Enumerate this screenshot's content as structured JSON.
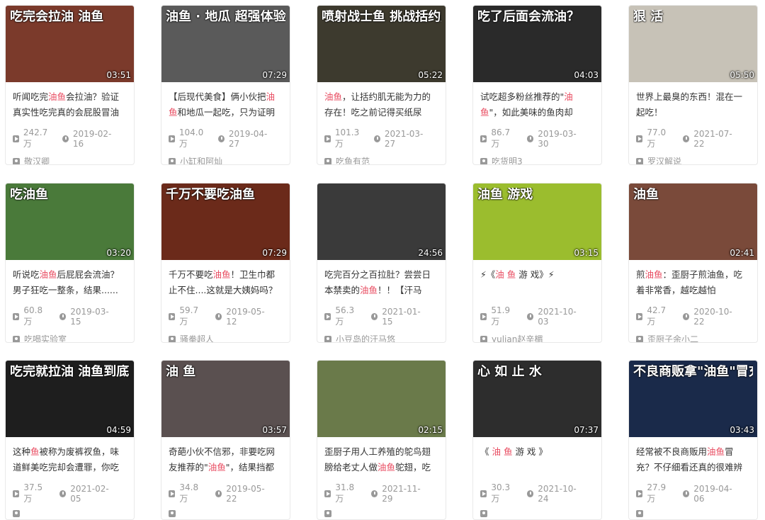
{
  "colors": {
    "highlight": "#e84a5f",
    "meta": "#999999",
    "title": "#333333"
  },
  "cards": [
    {
      "overlay": "吃完会拉油 油鱼",
      "duration": "03:51",
      "title_pre": "听闻吃完",
      "title_hl": "油鱼",
      "title_post": "会拉油？验证真实性吃完真的会屁股冒油",
      "views": "242.7万",
      "date": "2019-02-16",
      "author": "敬汉卿"
    },
    {
      "overlay": "油鱼 · 地瓜 超强体验",
      "duration": "07:29",
      "title_pre": "【后现代美食】俩小伙把",
      "title_hl": "油鱼",
      "title_post": "和地瓜一起吃，只为证明",
      "views": "104.0万",
      "date": "2019-04-27",
      "author": "小缸和阿灿"
    },
    {
      "overlay": "喷射战士鱼 挑战括约肌",
      "duration": "05:22",
      "title_pre": "",
      "title_hl": "油鱼",
      "title_post": "，让括约肌无能为力的存在！吃之前记得买纸尿",
      "views": "101.3万",
      "date": "2021-03-27",
      "author": "吃鱼有范"
    },
    {
      "overlay": "吃了后面会流油？",
      "duration": "04:03",
      "title_pre": "试吃超多粉丝推荐的\"",
      "title_hl": "油鱼",
      "title_post": "\"，如此美味的鱼肉却",
      "views": "86.7万",
      "date": "2019-03-30",
      "author": "吃货明3"
    },
    {
      "overlay": "狠 活",
      "duration": "05:50",
      "title_pre": "世界上最臭的东西！混在一起吃！",
      "title_hl": "",
      "title_post": "",
      "views": "77.0万",
      "date": "2021-07-22",
      "author": "罗汉解说"
    },
    {
      "overlay": "吃油鱼",
      "duration": "03:20",
      "title_pre": "听说吃",
      "title_hl": "油鱼",
      "title_post": "后屁屁会流油？男子狂吃一整条，结果......",
      "views": "60.8万",
      "date": "2019-03-15",
      "author": "吃喝实验室"
    },
    {
      "overlay": "千万不要吃油鱼",
      "duration": "07:29",
      "title_pre": "千万不要吃",
      "title_hl": "油鱼",
      "title_post": "！卫生巾都止不住....这就是大姨妈吗？",
      "views": "59.7万",
      "date": "2019-05-12",
      "author": "骚拳超人"
    },
    {
      "overlay": "",
      "duration": "24:56",
      "title_pre": "吃完百分之百拉肚？尝尝日本禁卖的",
      "title_hl": "油鱼",
      "title_post": "！！【汗马",
      "views": "56.3万",
      "date": "2021-01-15",
      "author": "小豆岛的汗马悠"
    },
    {
      "overlay": "油鱼 游戏",
      "duration": "03:15",
      "title_pre": "⚡《",
      "title_hl": "油 鱼",
      "title_post": " 游 戏》⚡",
      "views": "51.9万",
      "date": "2021-10-03",
      "author": "yulian赵辛楣"
    },
    {
      "overlay": "油鱼",
      "duration": "02:41",
      "title_pre": "煎",
      "title_hl": "油鱼",
      "title_post": "：歪厨子煎油鱼，吃着非常香，越吃越怕",
      "views": "42.7万",
      "date": "2020-10-22",
      "author": "歪厨子余小二"
    },
    {
      "overlay": "吃完就拉油 油鱼到底多可怕？",
      "duration": "04:59",
      "title_pre": "这种",
      "title_hl": "鱼",
      "title_post": "被称为废裤衩鱼，味道鲜美吃完却会遭罪，你吃",
      "views": "37.5万",
      "date": "2021-02-05",
      "author": ""
    },
    {
      "overlay": "油 鱼",
      "duration": "03:57",
      "title_pre": "奇葩小伙不信邪，非要吃网友推荐的\"",
      "title_hl": "油鱼",
      "title_post": "\"，结果挡都",
      "views": "34.8万",
      "date": "2019-05-22",
      "author": ""
    },
    {
      "overlay": "",
      "duration": "02:15",
      "title_pre": "歪厨子用人工养殖的鸵鸟翅膀给老丈人做",
      "title_hl": "油鱼",
      "title_post": "鸵翅，吃",
      "views": "31.8万",
      "date": "2021-11-29",
      "author": ""
    },
    {
      "overlay": "心 如 止 水",
      "duration": "07:37",
      "title_pre": "《 ",
      "title_hl": "油 鱼",
      "title_post": " 游 戏 》",
      "views": "30.3万",
      "date": "2021-10-24",
      "author": ""
    },
    {
      "overlay": "不良商贩拿\"油鱼\"冒充 真假鳕鱼",
      "duration": "03:43",
      "title_pre": "经常被不良商贩用",
      "title_hl": "油鱼",
      "title_post": "冒充？不仔细看还真的很难辨",
      "views": "27.9万",
      "date": "2019-04-06",
      "author": ""
    }
  ]
}
